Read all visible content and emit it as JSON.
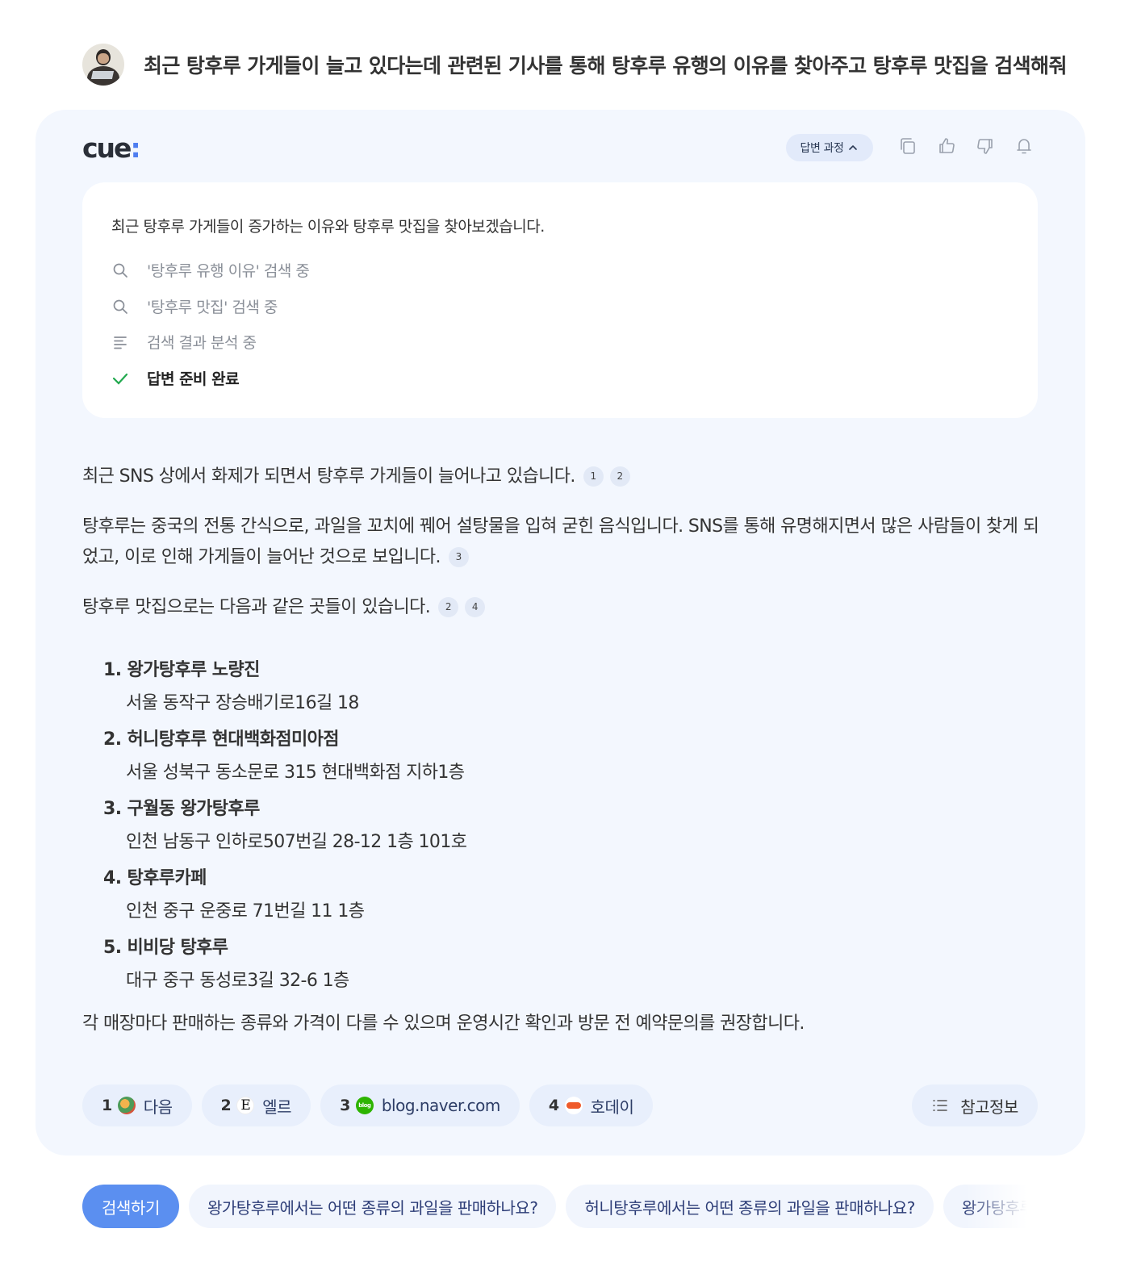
{
  "question": {
    "text": "최근 탕후루 가게들이 늘고 있다는데 관련된 기사를 통해 탕후루 유행의 이유를 찾아주고 탕후루 맛집을 검색해줘"
  },
  "answer_card": {
    "logo_text": "cue",
    "logo_colon": ":",
    "process_label": "답변 과정",
    "action_icons": [
      "copy-icon",
      "thumbs-up-icon",
      "thumbs-down-icon",
      "share-icon"
    ],
    "process": {
      "intro": "최근 탕후루 가게들이 증가하는 이유와 탕후루 맛집을 찾아보겠습니다.",
      "steps": [
        {
          "icon": "search-icon",
          "label": "'탕후루 유행 이유' 검색 중"
        },
        {
          "icon": "search-icon",
          "label": "'탕후루 맛집' 검색 중"
        },
        {
          "icon": "lines-icon",
          "label": "검색 결과 분석 중"
        },
        {
          "icon": "check-icon",
          "label": "답변 준비 완료"
        }
      ]
    },
    "paragraphs": [
      {
        "text": "최근 SNS 상에서 화제가 되면서 탕후루 가게들이 늘어나고 있습니다.",
        "cites": [
          "1",
          "2"
        ]
      },
      {
        "text": "탕후루는 중국의 전통 간식으로, 과일을 꼬치에 꿰어 설탕물을 입혀 굳힌 음식입니다. SNS를 통해 유명해지면서 많은 사람들이 찾게 되었고, 이로 인해 가게들이 늘어난 것으로 보입니다.",
        "cites": [
          "3"
        ]
      },
      {
        "text": "탕후루 맛집으로는 다음과 같은 곳들이 있습니다.",
        "cites": [
          "2",
          "4"
        ]
      }
    ],
    "shops": [
      {
        "name": "1. 왕가탕후루 노량진",
        "address": "서울 동작구 장승배기로16길 18"
      },
      {
        "name": "2. 허니탕후루 현대백화점미아점",
        "address": "서울 성북구 동소문로 315 현대백화점 지하1층"
      },
      {
        "name": "3. 구월동 왕가탕후루",
        "address": "인천 남동구 인하로507번길 28-12 1층 101호"
      },
      {
        "name": "4. 탕후루카페",
        "address": "인천 중구 운중로 71번길 11 1층"
      },
      {
        "name": "5. 비비당 탕후루",
        "address": "대구 중구 동성로3길 32-6 1층"
      }
    ],
    "closing": "각 매장마다 판매하는 종류와 가격이 다를 수 있으며 운영시간 확인과 방문 전 예약문의를 권장합니다.",
    "sources": [
      {
        "num": "1",
        "name": "다음",
        "favicon": "daum-favicon"
      },
      {
        "num": "2",
        "name": "엘르",
        "favicon": "elle-favicon",
        "glyph": "E"
      },
      {
        "num": "3",
        "name": "blog.naver.com",
        "favicon": "naver-blog-favicon",
        "glyph": "blog"
      },
      {
        "num": "4",
        "name": "호데이",
        "favicon": "hodei-favicon"
      }
    ],
    "references_label": "참고정보"
  },
  "suggestions": {
    "search_button": "검색하기",
    "items": [
      "왕가탕후루에서는 어떤 종류의 과일을 판매하나요?",
      "허니탕후루에서는 어떤 종류의 과일을 판매하나요?",
      "왕가탕후루에서는"
    ]
  },
  "colors": {
    "accent": "#5b8ff0",
    "card_background": "#f3f7fe",
    "success": "#22a94f"
  }
}
